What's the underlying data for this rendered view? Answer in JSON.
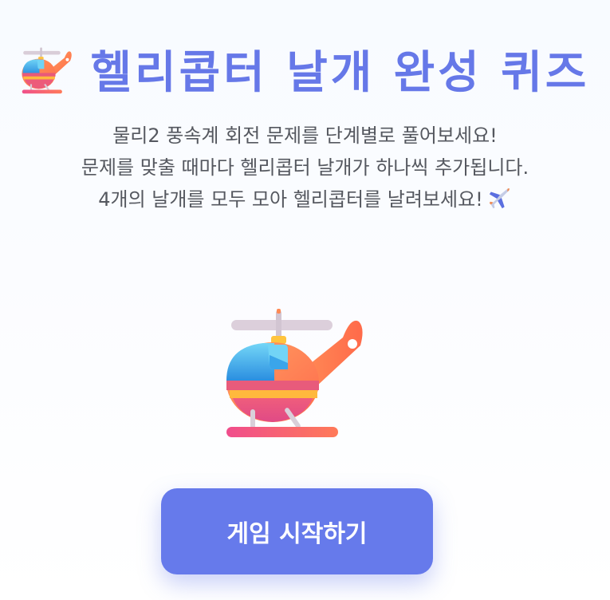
{
  "header": {
    "title": "헬리콥터 날개 완성 퀴즈",
    "title_icon": "helicopter-icon",
    "accent_color": "#6678e8"
  },
  "intro": {
    "line1": "물리2 풍속계 회전 문제를 단계별로 풀어보세요!",
    "line2": "문제를 맞출 때마다 헬리콥터 날개가 하나씩 추가됩니다.",
    "line3": "4개의 날개를 모두 모아 헬리콥터를 날려보세요!",
    "line3_icon": "airplane-icon"
  },
  "main": {
    "illustration": "helicopter-icon"
  },
  "actions": {
    "start_label": "게임 시작하기",
    "button_color": "#667aeb"
  }
}
